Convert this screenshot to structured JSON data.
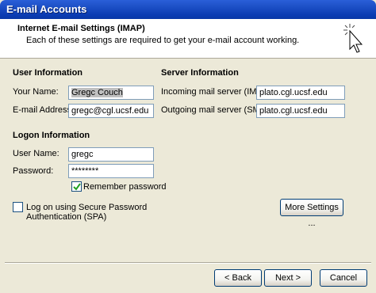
{
  "window": {
    "title": "E-mail Accounts"
  },
  "header": {
    "title": "Internet E-mail Settings (IMAP)",
    "subtitle": "Each of these settings are required to get your e-mail account working."
  },
  "user_info": {
    "heading": "User Information",
    "your_name_label": "Your Name:",
    "your_name_value": "Gregc Couch",
    "email_label": "E-mail Address:",
    "email_value": "gregc@cgl.ucsf.edu"
  },
  "server_info": {
    "heading": "Server Information",
    "incoming_label": "Incoming mail server (IMAP):",
    "incoming_value": "plato.cgl.ucsf.edu",
    "outgoing_label": "Outgoing mail server (SMTP):",
    "outgoing_value": "plato.cgl.ucsf.edu"
  },
  "logon_info": {
    "heading": "Logon Information",
    "username_label": "User Name:",
    "username_value": "gregc",
    "password_label": "Password:",
    "password_value": "********",
    "remember_label": "Remember password",
    "remember_checked": true
  },
  "spa": {
    "label_line1": "Log on using Secure Password",
    "label_line2": "Authentication (SPA)",
    "checked": false
  },
  "buttons": {
    "more_settings": "More Settings ...",
    "back": "< Back",
    "next": "Next >",
    "cancel": "Cancel"
  },
  "colors": {
    "titlebar": "#0a3bb2",
    "dialog_bg": "#ece9d8",
    "field_border": "#7f9db9"
  }
}
